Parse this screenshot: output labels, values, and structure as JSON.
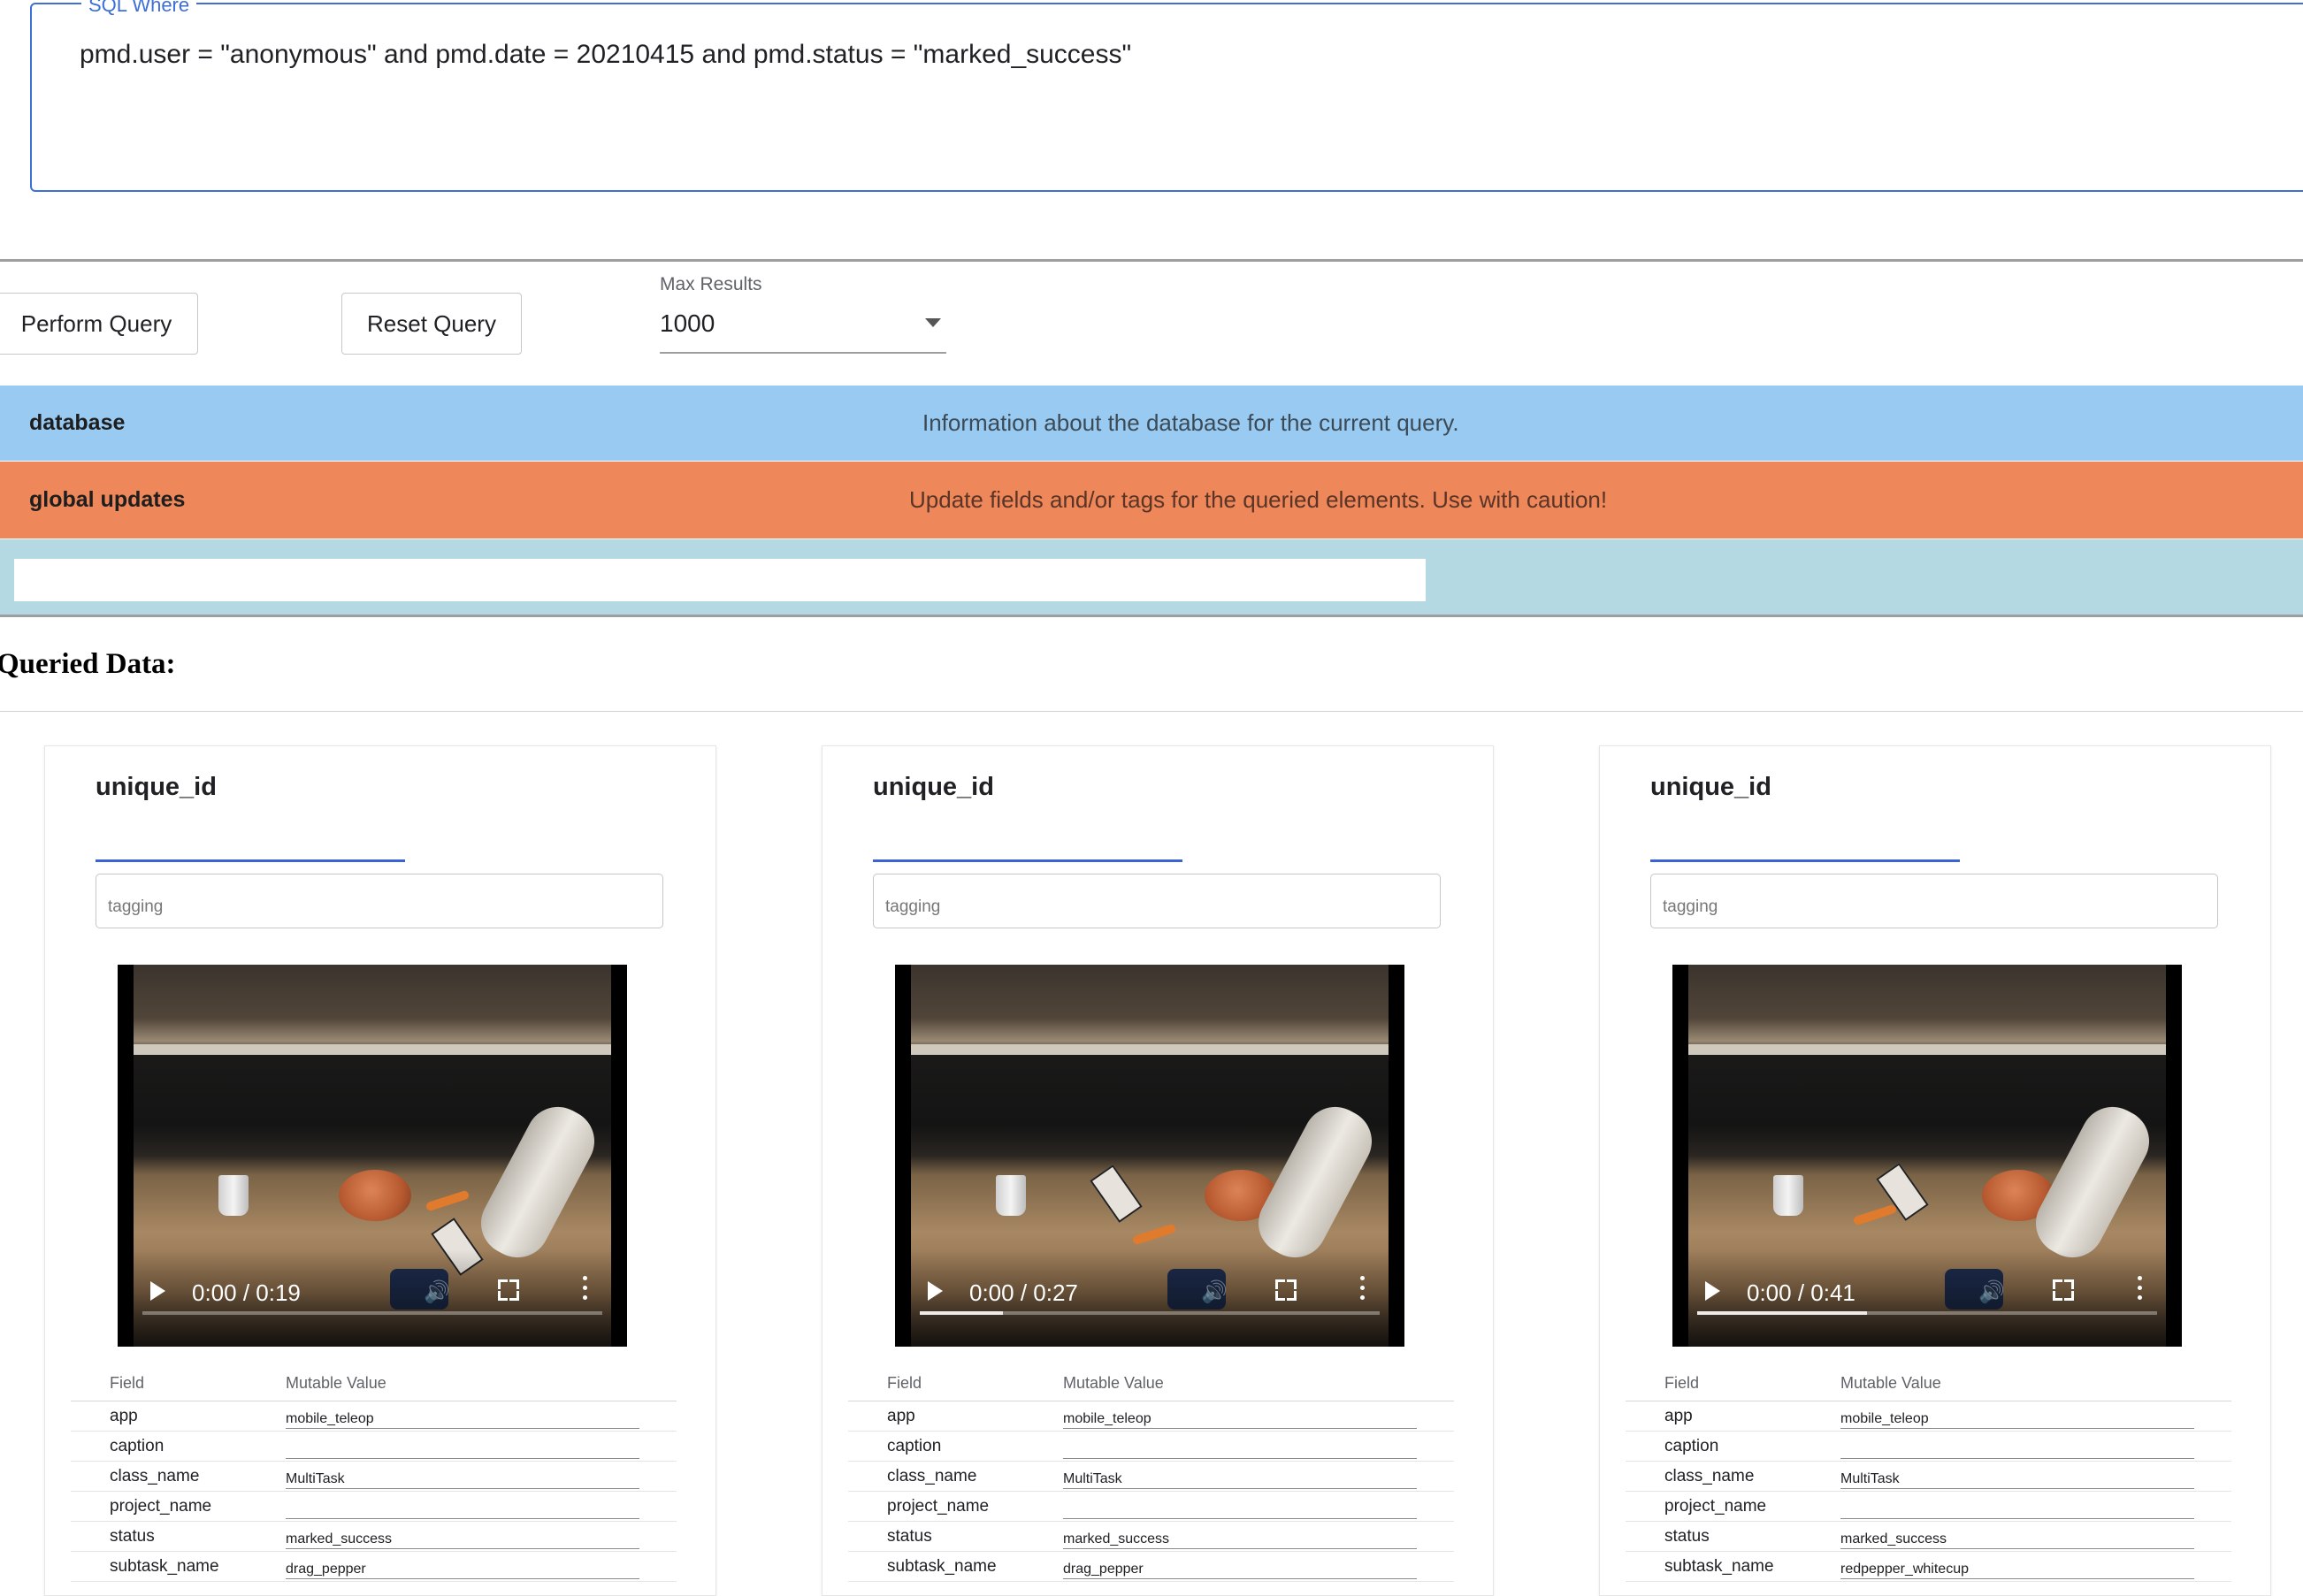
{
  "sql": {
    "legend": "SQL Where",
    "query": "pmd.user = \"anonymous\" and pmd.date = 20210415 and pmd.status = \"marked_success\""
  },
  "controls": {
    "perform_label": "Perform Query",
    "reset_label": "Reset Query",
    "max_results_label": "Max Results",
    "max_results_value": "1000"
  },
  "panels": {
    "database": {
      "title": "database",
      "description": "Information about the database for the current query.",
      "color": "#99cbf2"
    },
    "global_updates": {
      "title": "global updates",
      "description": "Update fields and/or tags for the queried elements. Use with caution!",
      "color": "#ee8759"
    }
  },
  "queried_title": "Queried Data:",
  "cards": [
    {
      "title": "unique_id",
      "tag_placeholder": "tagging",
      "video": {
        "time": "0:00 / 0:19",
        "progress": 0.0
      },
      "table_header": {
        "field": "Field",
        "value": "Mutable Value"
      },
      "rows": [
        {
          "field": "app",
          "value": "mobile_teleop"
        },
        {
          "field": "caption",
          "value": ""
        },
        {
          "field": "class_name",
          "value": "MultiTask"
        },
        {
          "field": "project_name",
          "value": ""
        },
        {
          "field": "status",
          "value": "marked_success"
        },
        {
          "field": "subtask_name",
          "value": "drag_pepper"
        }
      ]
    },
    {
      "title": "unique_id",
      "tag_placeholder": "tagging",
      "video": {
        "time": "0:00 / 0:27",
        "progress": 0.18
      },
      "table_header": {
        "field": "Field",
        "value": "Mutable Value"
      },
      "rows": [
        {
          "field": "app",
          "value": "mobile_teleop"
        },
        {
          "field": "caption",
          "value": ""
        },
        {
          "field": "class_name",
          "value": "MultiTask"
        },
        {
          "field": "project_name",
          "value": ""
        },
        {
          "field": "status",
          "value": "marked_success"
        },
        {
          "field": "subtask_name",
          "value": "drag_pepper"
        }
      ]
    },
    {
      "title": "unique_id",
      "tag_placeholder": "tagging",
      "video": {
        "time": "0:00 / 0:41",
        "progress": 0.37
      },
      "table_header": {
        "field": "Field",
        "value": "Mutable Value"
      },
      "rows": [
        {
          "field": "app",
          "value": "mobile_teleop"
        },
        {
          "field": "caption",
          "value": ""
        },
        {
          "field": "class_name",
          "value": "MultiTask"
        },
        {
          "field": "project_name",
          "value": ""
        },
        {
          "field": "status",
          "value": "marked_success"
        },
        {
          "field": "subtask_name",
          "value": "redpepper_whitecup"
        }
      ]
    }
  ]
}
